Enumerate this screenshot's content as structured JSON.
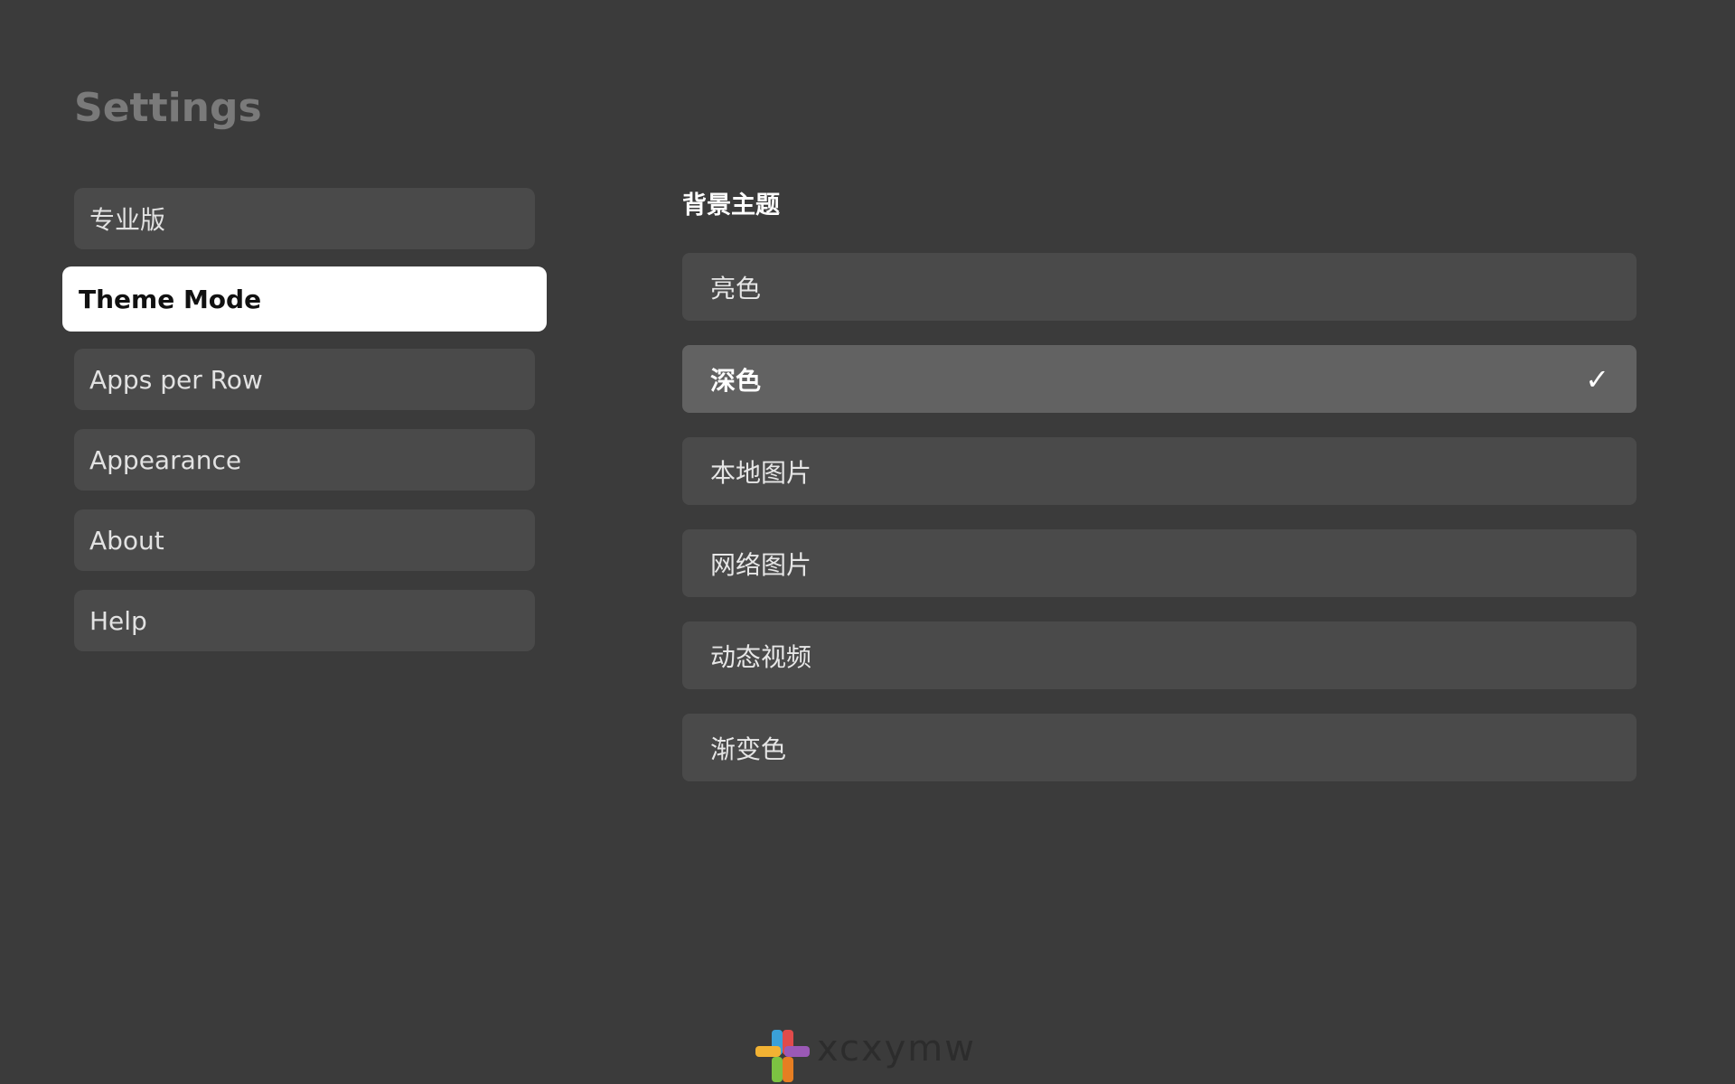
{
  "header": {
    "title": "Settings"
  },
  "sidebar": {
    "items": [
      {
        "label": "专业版",
        "selected": false
      },
      {
        "label": "Theme Mode",
        "selected": true
      },
      {
        "label": "Apps per Row",
        "selected": false
      },
      {
        "label": "Appearance",
        "selected": false
      },
      {
        "label": "About",
        "selected": false
      },
      {
        "label": "Help",
        "selected": false
      }
    ]
  },
  "main": {
    "section_title": "背景主题",
    "options": [
      {
        "label": "亮色",
        "selected": false
      },
      {
        "label": "深色",
        "selected": true
      },
      {
        "label": "本地图片",
        "selected": false
      },
      {
        "label": "网络图片",
        "selected": false
      },
      {
        "label": "动态视频",
        "selected": false
      },
      {
        "label": "渐变色",
        "selected": false
      }
    ],
    "check_glyph": "✓"
  },
  "watermark": {
    "text": "xcxymw"
  },
  "colors": {
    "background": "#3b3b3b",
    "item_bg": "#4a4a4a",
    "selected_item_bg": "#626262",
    "sidebar_selected_bg": "#ffffff"
  }
}
